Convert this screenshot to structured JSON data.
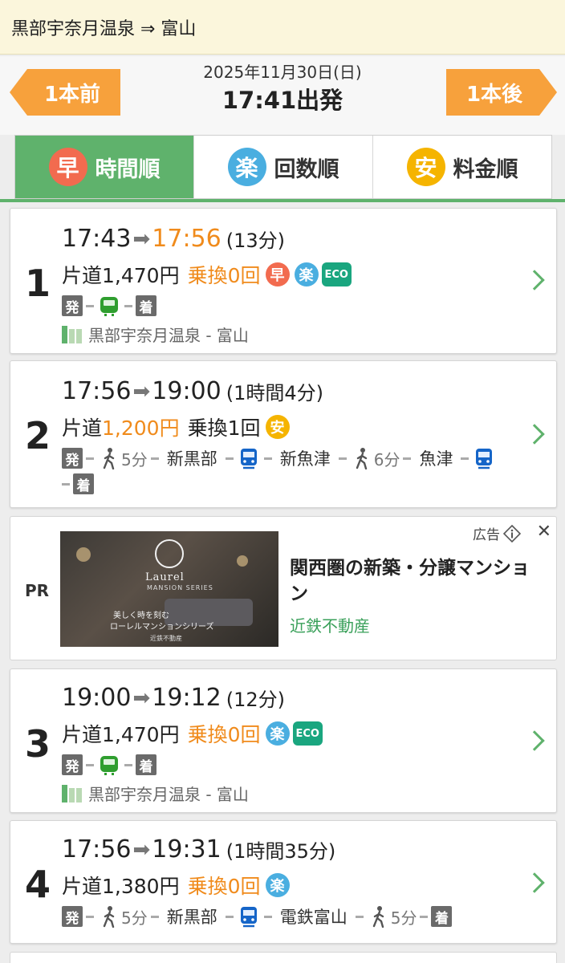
{
  "route": {
    "label": "黒部宇奈月温泉 ⇒ 富山"
  },
  "nav": {
    "prev_label": "1本前",
    "next_label": "1本後",
    "date": "2025年11月30日(日)",
    "departure": "17:41出発"
  },
  "tabs": [
    {
      "badge": "早",
      "label": "時間順",
      "badge_color": "#f26b4f",
      "active": true
    },
    {
      "badge": "楽",
      "label": "回数順",
      "badge_color": "#4aaee0",
      "active": false
    },
    {
      "badge": "安",
      "label": "料金順",
      "badge_color": "#f5b400",
      "active": false
    }
  ],
  "colors": {
    "accent": "#5fb26c",
    "orange": "#f08b1c",
    "button": "#f7a13c"
  },
  "routes": [
    {
      "num": "1",
      "dep": "17:43",
      "arrow": "➡",
      "arr": "17:56",
      "duration": "(13分)",
      "fare_prefix": "片道",
      "fare_amount": "1,470円",
      "transfer": "乗換0回",
      "badges": [
        "早",
        "楽",
        "ECO"
      ],
      "seg_start": "発",
      "seg_end": "着",
      "line": "黒部宇奈月温泉 - 富山"
    },
    {
      "num": "2",
      "dep": "17:56",
      "arrow": "➡",
      "arr": "19:00",
      "duration": "(1時間4分)",
      "fare_prefix": "片道",
      "fare_amount": "1,200円",
      "transfer": "乗換1回",
      "badges": [
        "安"
      ],
      "seg_start": "発",
      "seg_end": "着",
      "walk1": "5分",
      "station1": "新黒部",
      "station2": "新魚津",
      "walk2": "6分",
      "station3": "魚津"
    },
    {
      "num": "3",
      "dep": "19:00",
      "arrow": "➡",
      "arr": "19:12",
      "duration": "(12分)",
      "fare_prefix": "片道",
      "fare_amount": "1,470円",
      "transfer": "乗換0回",
      "badges": [
        "楽",
        "ECO"
      ],
      "seg_start": "発",
      "seg_end": "着",
      "line": "黒部宇奈月温泉 - 富山"
    },
    {
      "num": "4",
      "dep": "17:56",
      "arrow": "➡",
      "arr": "19:31",
      "duration": "(1時間35分)",
      "fare_prefix": "片道",
      "fare_amount": "1,380円",
      "transfer": "乗換0回",
      "badges": [
        "楽"
      ],
      "seg_start": "発",
      "seg_end": "着",
      "walk1": "5分",
      "station1": "新黒部",
      "station2": "電鉄富山",
      "walk2": "5分"
    }
  ],
  "ad": {
    "pr": "PR",
    "label": "広告",
    "title": "関西圏の新築・分譲マンション",
    "sponsor": "近鉄不動産",
    "brand": "Laurel",
    "brand_sub": "MANSION SERIES",
    "copy1": "美しく時を刻む",
    "copy2": "ローレルマンションシリーズ",
    "copy3": "近鉄不動産"
  }
}
